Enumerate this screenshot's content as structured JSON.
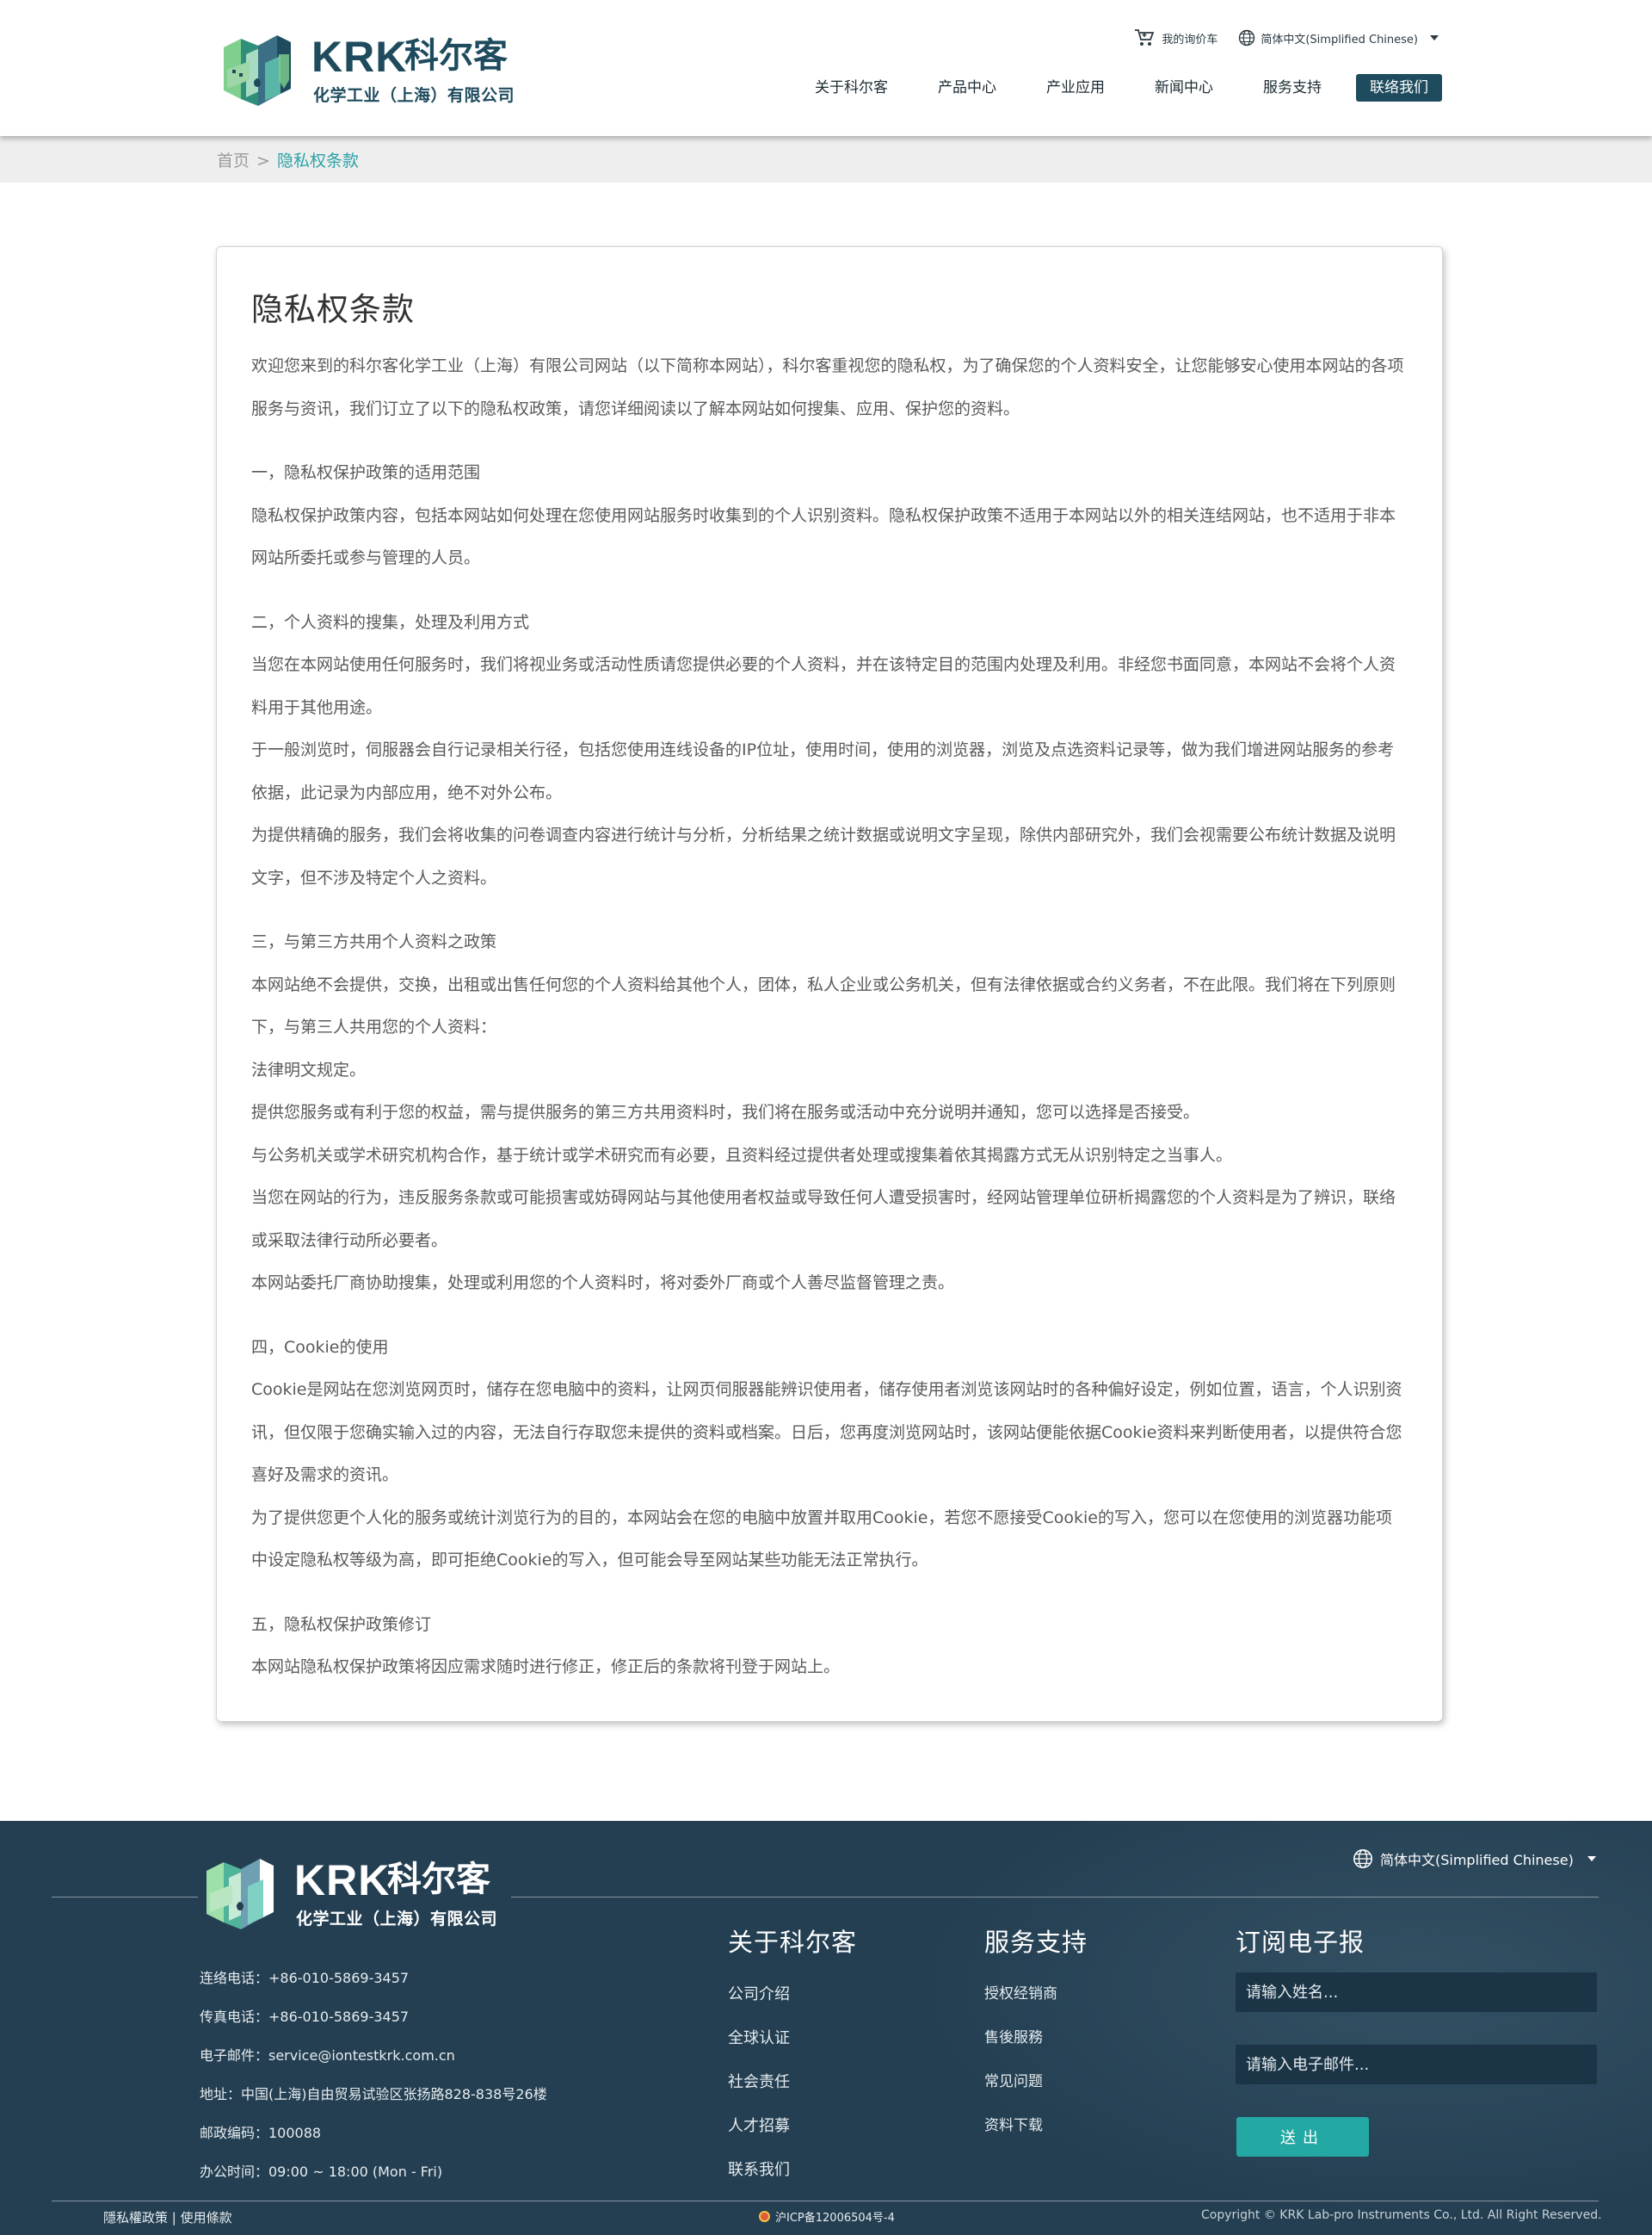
{
  "header": {
    "logo": {
      "en": "KRK",
      "cn": "科尔客",
      "sub": "化学工业（上海）有限公司"
    },
    "cart_label": "我的询价车",
    "language_label": "简体中文(Simplified Chinese)",
    "nav": [
      {
        "label": "关于科尔客"
      },
      {
        "label": "产品中心"
      },
      {
        "label": "产业应用"
      },
      {
        "label": "新闻中心"
      },
      {
        "label": "服务支持"
      },
      {
        "label": "联络我们"
      }
    ]
  },
  "breadcrumb": {
    "home": "首页",
    "separator": ">",
    "current": "隐私权条款"
  },
  "content": {
    "title": "隐私权条款",
    "intro": "欢迎您来到的科尔客化学工业（上海）有限公司网站（以下简称本网站），科尔客重视您的隐私权，为了确保您的个人资料安全，让您能够安心使用本网站的各项服务与资讯，我们订立了以下的隐私权政策，请您详细阅读以了解本网站如何搜集、应用、保护您的资料。",
    "sections": [
      {
        "heading": "一，隐私权保护政策的适用范围",
        "paragraphs": [
          "隐私权保护政策内容，包括本网站如何处理在您使用网站服务时收集到的个人识别资料。隐私权保护政策不适用于本网站以外的相关连结网站，也不适用于非本网站所委托或参与管理的人员。"
        ]
      },
      {
        "heading": "二，个人资料的搜集，处理及利用方式",
        "paragraphs": [
          "当您在本网站使用任何服务时，我们将视业务或活动性质请您提供必要的个人资料，并在该特定目的范围内处理及利用。非经您书面同意，本网站不会将个人资料用于其他用途。",
          "于一般浏览时，伺服器会自行记录相关行径，包括您使用连线设备的IP位址，使用时间，使用的浏览器，浏览及点选资料记录等，做为我们增进网站服务的参考依据，此记录为内部应用，绝不对外公布。",
          "为提供精确的服务，我们会将收集的问卷调查内容进行统计与分析，分析结果之统计数据或说明文字呈现，除供内部研究外，我们会视需要公布统计数据及说明文字，但不涉及特定个人之资料。"
        ]
      },
      {
        "heading": "三，与第三方共用个人资料之政策",
        "paragraphs": [
          "本网站绝不会提供，交换，出租或出售任何您的个人资料给其他个人，团体，私人企业或公务机关，但有法律依据或合约义务者，不在此限。我们将在下列原则下，与第三人共用您的个人资料：",
          "法律明文规定。",
          "提供您服务或有利于您的权益，需与提供服务的第三方共用资料时，我们将在服务或活动中充分说明并通知，您可以选择是否接受。",
          "与公务机关或学术研究机构合作，基于统计或学术研究而有必要，且资料经过提供者处理或搜集着依其揭露方式无从识别特定之当事人。",
          "当您在网站的行为，违反服务条款或可能损害或妨碍网站与其他使用者权益或导致任何人遭受损害时，经网站管理单位研析揭露您的个人资料是为了辨识，联络或采取法律行动所必要者。",
          "本网站委托厂商协助搜集，处理或利用您的个人资料时，将对委外厂商或个人善尽监督管理之责。"
        ]
      },
      {
        "heading": "四，Cookie的使用",
        "paragraphs": [
          "Cookie是网站在您浏览网页时，储存在您电脑中的资料，让网页伺服器能辨识使用者，储存使用者浏览该网站时的各种偏好设定，例如位置，语言，个人识别资讯，但仅限于您确实输入过的内容，无法自行存取您未提供的资料或档案。日后，您再度浏览网站时，该网站便能依据Cookie资料来判断使用者，以提供符合您喜好及需求的资讯。",
          "为了提供您更个人化的服务或统计浏览行为的目的，本网站会在您的电脑中放置并取用Cookie，若您不愿接受Cookie的写入，您可以在您使用的浏览器功能项中设定隐私权等级为高，即可拒绝Cookie的写入，但可能会导至网站某些功能无法正常执行。"
        ]
      },
      {
        "heading": "五，隐私权保护政策修订",
        "paragraphs": [
          "本网站隐私权保护政策将因应需求随时进行修正，修正后的条款将刊登于网站上。"
        ]
      }
    ]
  },
  "footer": {
    "logo": {
      "en": "KRK",
      "cn": "科尔客",
      "sub": "化学工业（上海）有限公司"
    },
    "language_label": "简体中文(Simplified Chinese)",
    "info": [
      "连络电话：+86-010-5869-3457",
      "传真电话：+86-010-5869-3457",
      "电子邮件：service@iontestkrk.com.cn",
      "地址：中国(上海)自由贸易试验区张扬路828-838号26楼",
      "邮政编码：100088",
      "办公时间：09:00 ~ 18:00 (Mon - Fri)"
    ],
    "col_about": {
      "title": "关于科尔客",
      "links": [
        "公司介绍",
        "全球认证",
        "社会责任",
        "人才招募",
        "联系我们"
      ]
    },
    "col_service": {
      "title": "服务支持",
      "links": [
        "授权经销商",
        "售後服務",
        "常见问题",
        "资料下载"
      ]
    },
    "newsletter": {
      "title": "订阅电子报",
      "name_placeholder": "请输入姓名...",
      "email_placeholder": "请输入电子邮件...",
      "submit_label": "送出"
    },
    "bottom": {
      "left": "隱私權政策 | 使用條款",
      "icp": "沪ICP备12006504号-4",
      "copyright": "Copyright © KRK Lab-pro Instruments Co., Ltd. All Right Reserved."
    }
  },
  "colors": {
    "brand": "#1e4b5d",
    "accent": "#2ba3a6",
    "footer_bg": "#243f52",
    "button": "#24a8a3"
  }
}
